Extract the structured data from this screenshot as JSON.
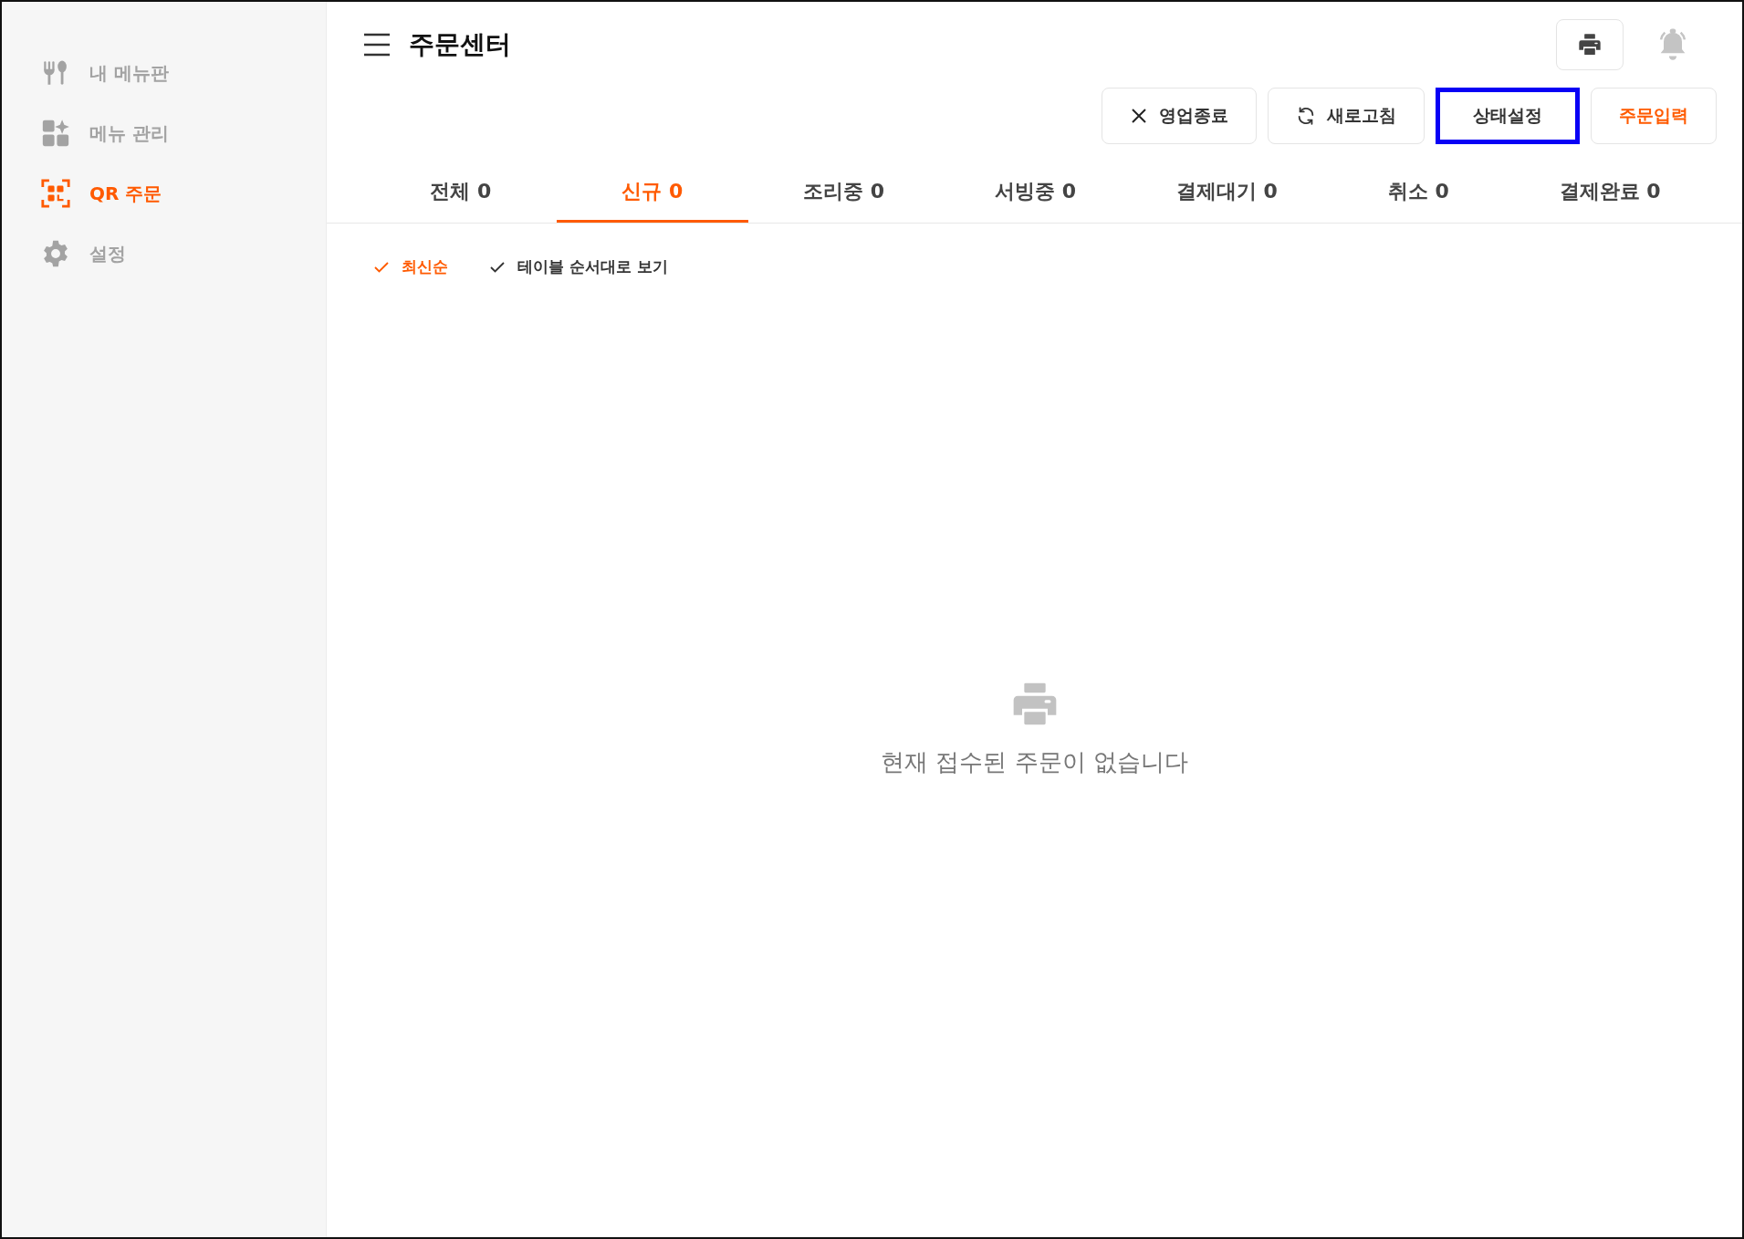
{
  "sidebar": {
    "items": [
      {
        "kind": "utensils",
        "label": "내 메뉴판",
        "selected": false
      },
      {
        "kind": "widgets",
        "label": "메뉴 관리",
        "selected": false
      },
      {
        "kind": "qr",
        "label": "QR 주문",
        "selected": true
      },
      {
        "kind": "gear",
        "label": "설정",
        "selected": false
      }
    ]
  },
  "header": {
    "title": "주문센터"
  },
  "actions": [
    {
      "kind": "close",
      "label": "영업종료",
      "highlighted": false,
      "accent": false
    },
    {
      "kind": "refresh",
      "label": "새로고침",
      "highlighted": false,
      "accent": false
    },
    {
      "kind": "plain",
      "label": "상태설정",
      "highlighted": true,
      "accent": false
    },
    {
      "kind": "plain",
      "label": "주문입력",
      "highlighted": false,
      "accent": true
    }
  ],
  "tabs": [
    {
      "label": "전체 0",
      "selected": false
    },
    {
      "label": "신규 0",
      "selected": true
    },
    {
      "label": "조리중 0",
      "selected": false
    },
    {
      "label": "서빙중 0",
      "selected": false
    },
    {
      "label": "결제대기 0",
      "selected": false
    },
    {
      "label": "취소 0",
      "selected": false
    },
    {
      "label": "결제완료 0",
      "selected": false
    }
  ],
  "sort_options": [
    {
      "label": "최신순",
      "selected": true
    },
    {
      "label": "테이블 순서대로 보기",
      "selected": false
    }
  ],
  "empty_state": {
    "message": "현재 접수된 주문이 없습니다"
  }
}
